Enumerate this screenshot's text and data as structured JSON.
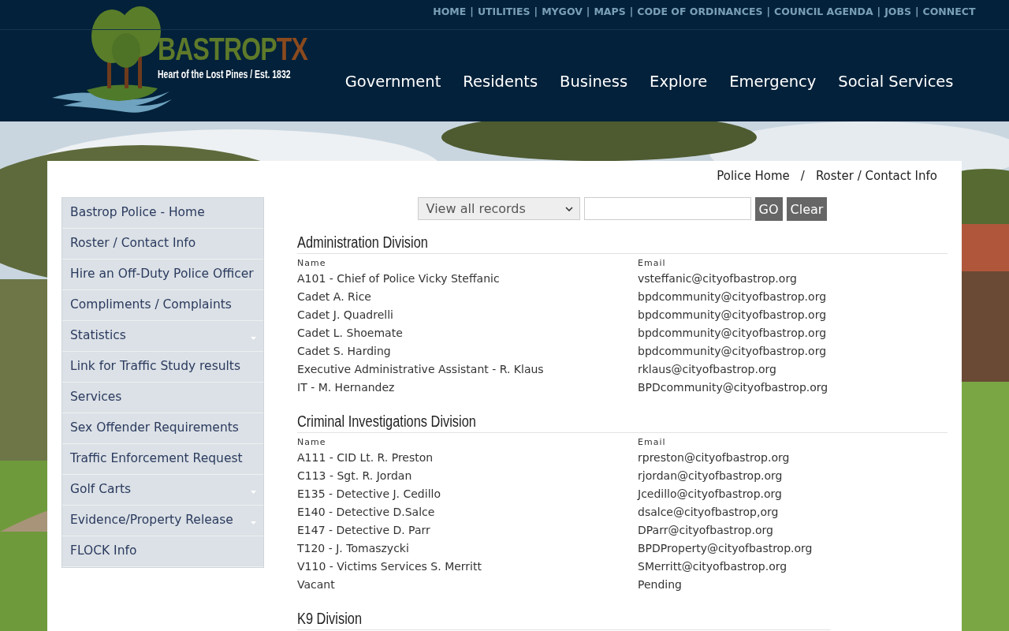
{
  "header": {
    "logo": {
      "name_main": "BASTROP",
      "name_suffix": "TX",
      "tagline": "Heart of the Lost Pines / Est. 1832"
    },
    "top_links": {
      "separator": "|",
      "items": [
        "HOME",
        "UTILITIES",
        "MYGOV",
        "MAPS",
        "CODE OF ORDINANCES",
        "COUNCIL AGENDA",
        "JOBS",
        "CONNECT"
      ]
    },
    "main_nav": [
      "Government",
      "Residents",
      "Business",
      "Explore",
      "Emergency",
      "Social Services"
    ]
  },
  "breadcrumb": {
    "separator": "/",
    "items": [
      "Police Home",
      "Roster / Contact Info"
    ]
  },
  "sidebar": {
    "items": [
      {
        "label": "Bastrop Police - Home",
        "submenu": false
      },
      {
        "label": "Roster / Contact Info",
        "submenu": false
      },
      {
        "label": "Hire an Off-Duty Police Officer",
        "submenu": false
      },
      {
        "label": "Compliments / Complaints",
        "submenu": false
      },
      {
        "label": "Statistics",
        "submenu": true
      },
      {
        "label": "Link for Traffic Study results",
        "submenu": false
      },
      {
        "label": "Services",
        "submenu": false
      },
      {
        "label": "Sex Offender Requirements",
        "submenu": false
      },
      {
        "label": "Traffic Enforcement Request",
        "submenu": false
      },
      {
        "label": "Golf Carts",
        "submenu": true
      },
      {
        "label": "Evidence/Property Release",
        "submenu": true
      },
      {
        "label": "FLOCK Info",
        "submenu": false
      }
    ]
  },
  "filter": {
    "select_value": "View all records",
    "buttons": [
      "GO",
      "Clear"
    ]
  },
  "divisions": [
    {
      "title": "Administration Division",
      "columns": [
        "Name",
        "Email"
      ],
      "rows": [
        [
          "A101 - Chief of Police Vicky Steffanic",
          "vsteffanic@cityofbastrop.org"
        ],
        [
          "Cadet A. Rice",
          "bpdcommunity@cityofbastrop.org"
        ],
        [
          "Cadet J. Quadrelli",
          "bpdcommunity@cityofbastrop.org"
        ],
        [
          "Cadet L. Shoemate",
          "bpdcommunity@cityofbastrop.org"
        ],
        [
          "Cadet S. Harding",
          "bpdcommunity@cityofbastrop.org"
        ],
        [
          "Executive Administrative Assistant - R. Klaus",
          "rklaus@cityofbastrop.org"
        ],
        [
          "IT - M. Hernandez",
          "BPDcommunity@cityofbastrop.org"
        ]
      ]
    },
    {
      "title": "Criminal Investigations Division",
      "columns": [
        "Name",
        "Email"
      ],
      "rows": [
        [
          "A111 - CID Lt. R. Preston",
          "rpreston@cityofbastrop.org"
        ],
        [
          "C113 - Sgt. R. Jordan",
          "rjordan@cityofbastrop.org"
        ],
        [
          "E135 - Detective J. Cedillo",
          "Jcedillo@cityofbastrop.org"
        ],
        [
          "E140 - Detective D.Salce",
          "dsalce@cityofbastrop,org"
        ],
        [
          "E147 - Detective D. Parr",
          "DParr@cityofbastrop.org"
        ],
        [
          "T120 - J. Tomaszycki",
          "BPDProperty@cityofbastrop.org"
        ],
        [
          "V110 - Victims Services S. Merritt",
          "SMerritt@cityofbastrop.org"
        ],
        [
          "Vacant",
          "Pending"
        ]
      ]
    },
    {
      "title": "K9 Division"
    }
  ]
}
